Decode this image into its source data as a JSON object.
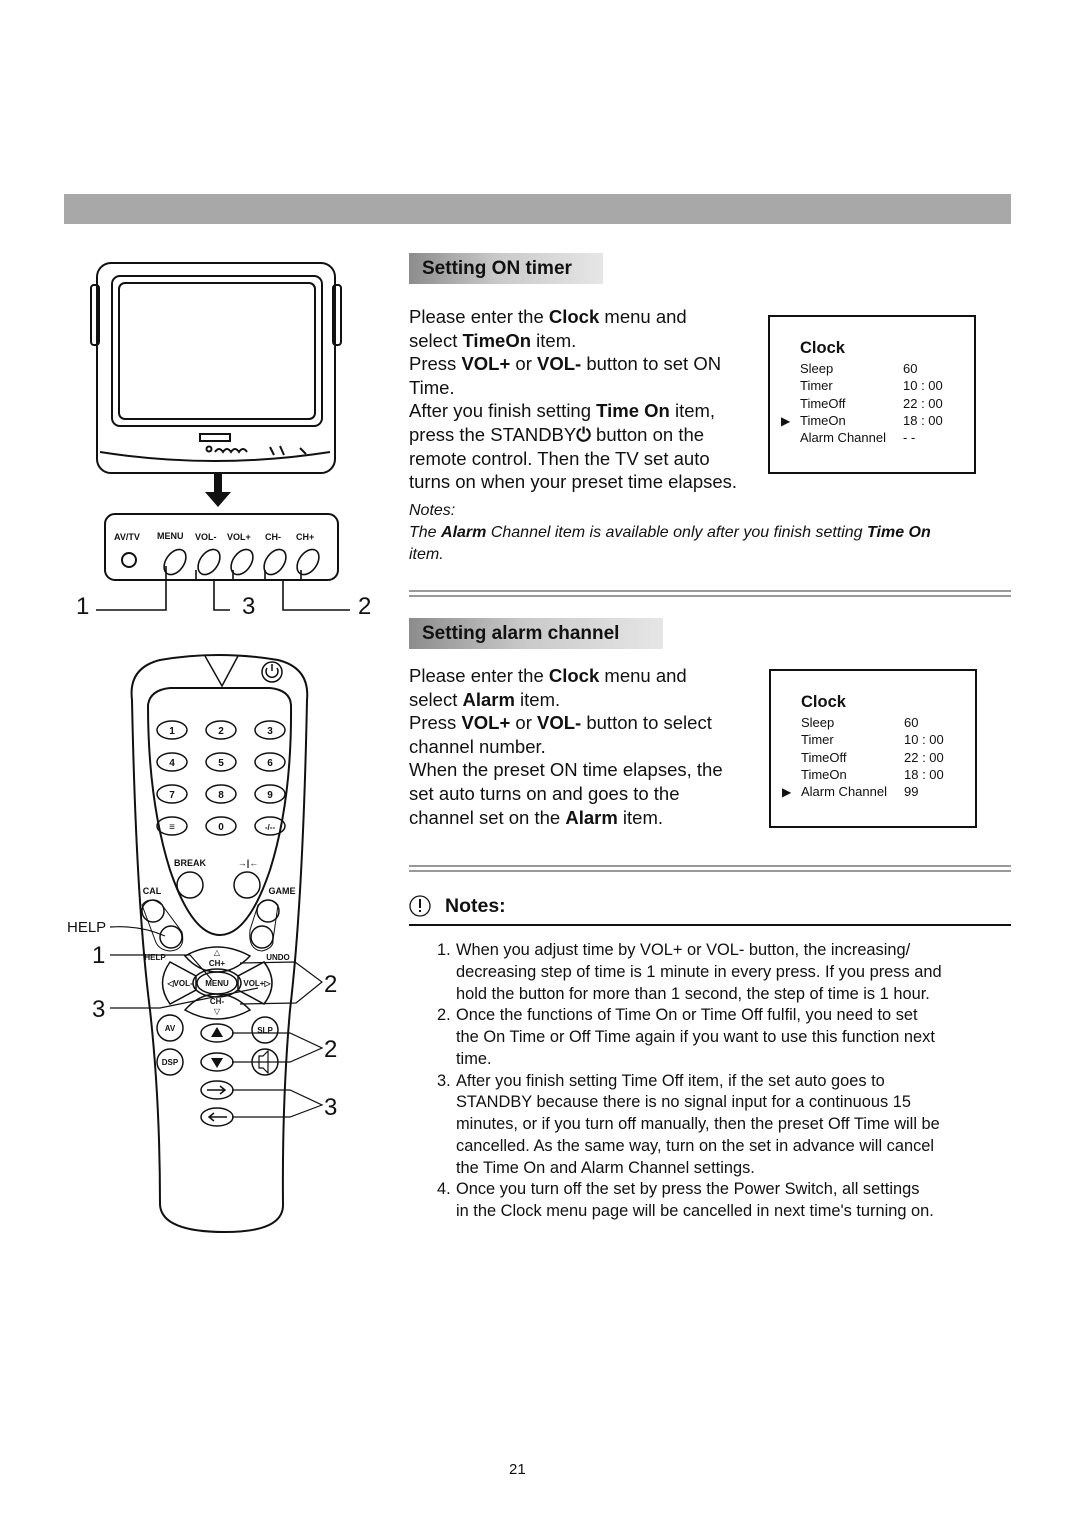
{
  "section1": {
    "heading": "Setting ON timer",
    "lines": [
      [
        {
          "t": "Please enter the "
        },
        {
          "t": "Clock",
          "b": true
        },
        {
          "t": " menu and"
        }
      ],
      [
        {
          "t": "select "
        },
        {
          "t": "TimeOn",
          "b": true
        },
        {
          "t": " item."
        }
      ],
      [
        {
          "t": "Press "
        },
        {
          "t": "VOL+",
          "b": true
        },
        {
          "t": " or "
        },
        {
          "t": "VOL-",
          "b": true
        },
        {
          "t": " button to set ON"
        }
      ],
      [
        {
          "t": "Time."
        }
      ],
      [
        {
          "t": "After you finish setting "
        },
        {
          "t": "Time On",
          "b": true
        },
        {
          "t": " item,"
        }
      ],
      [
        {
          "t": "press the STANDBY"
        },
        {
          "t": "⏻",
          "b": true
        },
        {
          "t": " button on the"
        }
      ],
      [
        {
          "t": "remote control. Then the TV set auto"
        }
      ],
      [
        {
          "t": "turns on when your preset time elapses."
        }
      ]
    ],
    "osd": {
      "title": "Clock",
      "rows": [
        {
          "label": "Sleep",
          "value": "60",
          "selected": false
        },
        {
          "label": "Timer",
          "value": "10 : 00",
          "selected": false
        },
        {
          "label": "TimeOff",
          "value": "22 : 00",
          "selected": false
        },
        {
          "label": "TimeOn",
          "value": "18 : 00",
          "selected": true
        },
        {
          "label": "Alarm Channel",
          "value": "- -",
          "selected": false
        }
      ]
    },
    "notes_label": "Notes:",
    "note_lines": [
      [
        {
          "t": "The "
        },
        {
          "t": "Alarm",
          "b": true
        },
        {
          "t": " Channel item is available only after you finish setting "
        },
        {
          "t": "Time On",
          "b": true
        }
      ],
      [
        {
          "t": "item."
        }
      ]
    ]
  },
  "section2": {
    "heading": "Setting alarm channel",
    "lines": [
      [
        {
          "t": "Please enter the "
        },
        {
          "t": "Clock",
          "b": true
        },
        {
          "t": " menu and"
        }
      ],
      [
        {
          "t": "select "
        },
        {
          "t": "Alarm",
          "b": true
        },
        {
          "t": " item."
        }
      ],
      [
        {
          "t": "Press "
        },
        {
          "t": "VOL+",
          "b": true
        },
        {
          "t": " or "
        },
        {
          "t": "VOL-",
          "b": true
        },
        {
          "t": " button to select"
        }
      ],
      [
        {
          "t": "channel number."
        }
      ],
      [
        {
          "t": "When the preset ON time elapses, the"
        }
      ],
      [
        {
          "t": "set auto turns on and goes to the"
        }
      ],
      [
        {
          "t": "channel set on the "
        },
        {
          "t": "Alarm",
          "b": true
        },
        {
          "t": " item."
        }
      ]
    ],
    "osd": {
      "title": "Clock",
      "rows": [
        {
          "label": "Sleep",
          "value": "60",
          "selected": false
        },
        {
          "label": "Timer",
          "value": "10 : 00",
          "selected": false
        },
        {
          "label": "TimeOff",
          "value": "22 : 00",
          "selected": false
        },
        {
          "label": "TimeOn",
          "value": "18 : 00",
          "selected": false
        },
        {
          "label": "Alarm Channel",
          "value": "99",
          "selected": true
        }
      ]
    }
  },
  "notes": {
    "heading": "Notes:",
    "icon": "exclamation-icon",
    "items": [
      {
        "num": "1.",
        "lines": [
          "When you adjust time by VOL+ or VOL- button, the increasing/",
          "decreasing step of time is 1 minute in every press. If you press and",
          "hold the button for more than 1 second, the step of time is 1 hour."
        ]
      },
      {
        "num": "2.",
        "lines": [
          "Once the functions of Time On or Time Off fulfil, you need to set",
          "the On Time or Off Time again if you want to use this function next",
          "time."
        ]
      },
      {
        "num": "3.",
        "lines": [
          "After you finish setting Time Off item, if the set auto goes to",
          "STANDBY because there is no signal input for a continuous 15",
          "minutes, or if you turn off manually, then the preset Off Time will be",
          "cancelled. As the same way, turn on the set in advance will cancel",
          "the Time On and Alarm Channel settings."
        ]
      },
      {
        "num": "4.",
        "lines": [
          "Once you turn off the set by press the Power Switch, all settings",
          "in the Clock menu page will be cancelled in next time's turning on."
        ]
      }
    ]
  },
  "tv_panel": {
    "labels": [
      "AV/TV",
      "MENU",
      "VOL-",
      "VOL+",
      "CH-",
      "CH+"
    ],
    "callouts": [
      "1",
      "3",
      "2"
    ]
  },
  "remote": {
    "keys": [
      "1",
      "2",
      "3",
      "4",
      "5",
      "6",
      "7",
      "8",
      "9",
      "0",
      "-/--"
    ],
    "break": "BREAK",
    "hold": "→|←",
    "cal": "CAL",
    "game": "GAME",
    "help_small": "HELP",
    "undo": "UNDO",
    "ch_plus": "CH+",
    "ch_minus": "CH-",
    "vol_minus": "◁VOL-",
    "vol_plus": "VOL+▷",
    "menu": "MENU",
    "av": "AV",
    "dsp": "DSP",
    "slp": "SLP",
    "help_callout": "HELP",
    "callouts": [
      "1",
      "3",
      "2",
      "2",
      "3"
    ]
  },
  "page_number": "21"
}
